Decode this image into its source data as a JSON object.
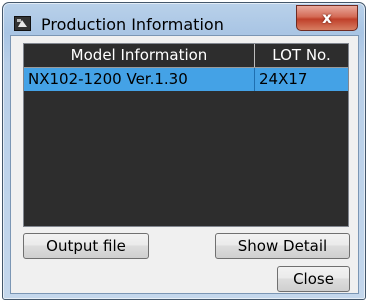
{
  "window": {
    "title": "Production Information",
    "close_glyph": "x",
    "app_icon": "app-icon"
  },
  "table": {
    "columns": [
      "Model Information",
      "LOT No."
    ],
    "rows": [
      [
        "NX102-1200 Ver.1.30",
        "24X17"
      ]
    ],
    "selected_row": 0
  },
  "buttons": {
    "output_file": "Output file",
    "show_detail": "Show Detail",
    "close": "Close"
  },
  "colors": {
    "title_bar": "#a9c5e4",
    "list_background": "#2d2d2d",
    "selection": "#44a2e6",
    "close_button": "#c0402a"
  }
}
